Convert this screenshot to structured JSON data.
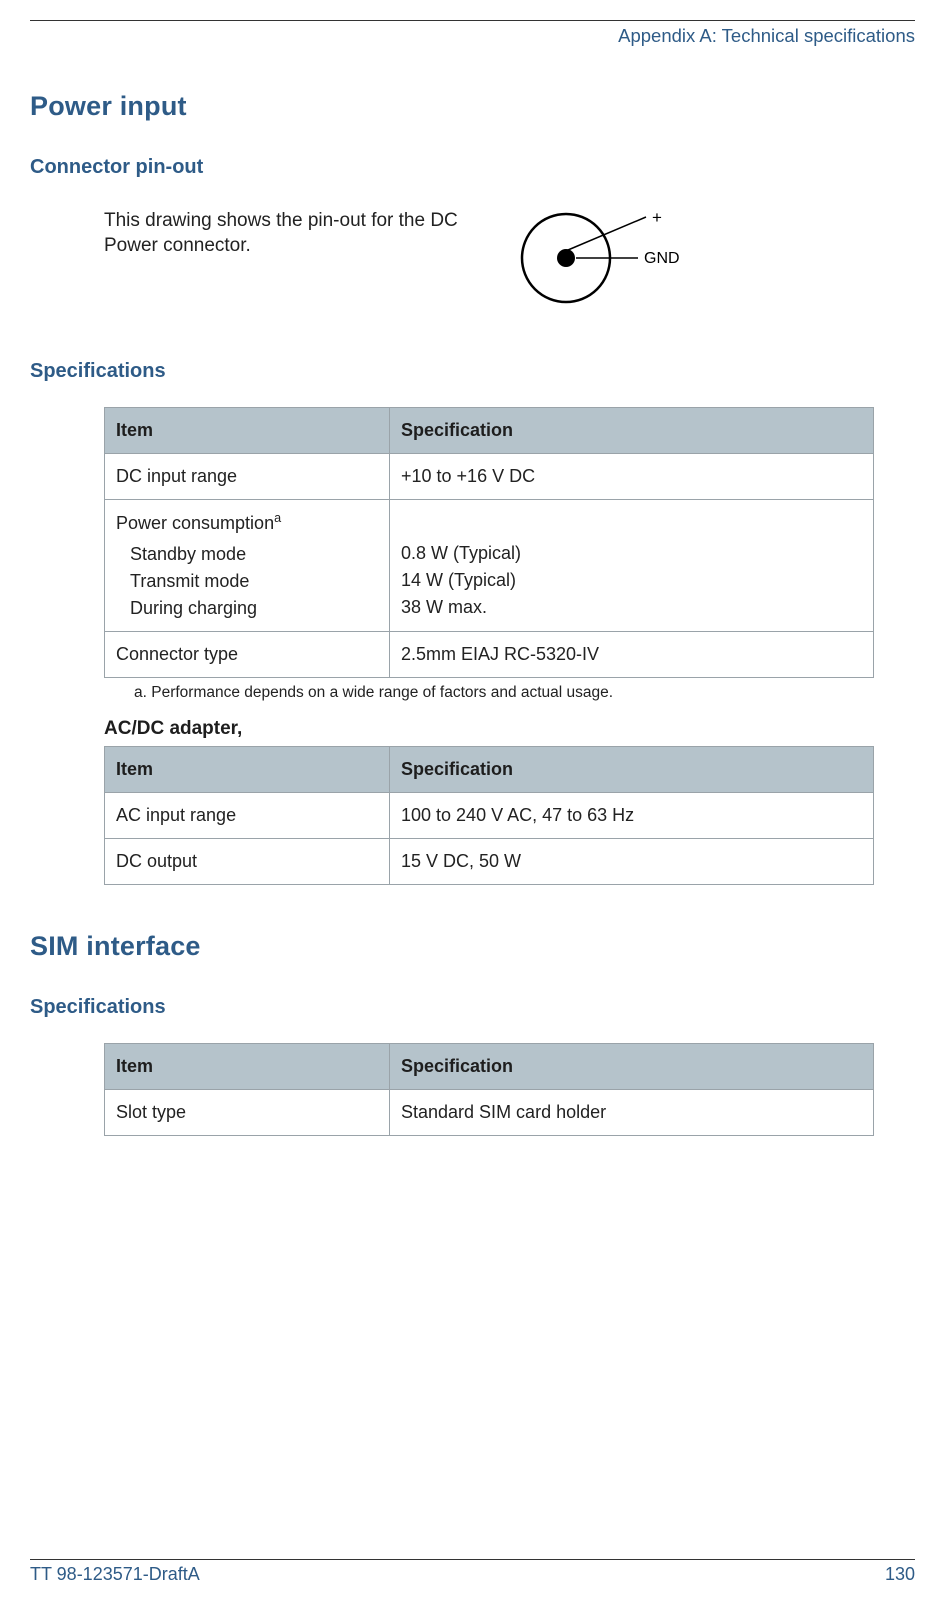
{
  "header": {
    "breadcrumb": "Appendix A: Technical specifications"
  },
  "sections": {
    "power_input": {
      "title": "Power input",
      "pinout": {
        "heading": "Connector pin-out",
        "text": "This drawing shows the pin-out for the DC Power connector.",
        "label_plus": "+",
        "label_gnd": "GND"
      },
      "specs": {
        "heading": "Specifications",
        "columns": {
          "item": "Item",
          "spec": "Specification"
        },
        "rows": {
          "dc_range": {
            "item": "DC input range",
            "spec": "+10 to +16 V DC"
          },
          "power_consumption": {
            "item_label": "Power consumption",
            "sup": "a",
            "standby_item": "Standby mode",
            "standby_spec": "0.8 W (Typical)",
            "transmit_item": "Transmit mode",
            "transmit_spec": "14 W (Typical)",
            "charging_item": "During charging",
            "charging_spec": "38 W max."
          },
          "connector": {
            "item": "Connector type",
            "spec": "2.5mm EIAJ RC-5320-IV"
          }
        },
        "footnote": "a.  Performance depends on a wide range of factors and actual usage."
      },
      "adapter": {
        "heading": "AC/DC adapter,",
        "columns": {
          "item": "Item",
          "spec": "Specification"
        },
        "rows": {
          "ac_range": {
            "item": "AC input range",
            "spec": "100 to 240 V AC, 47 to 63 Hz"
          },
          "dc_out": {
            "item": "DC output",
            "spec": "15 V DC, 50 W"
          }
        }
      }
    },
    "sim": {
      "title": "SIM interface",
      "specs": {
        "heading": "Specifications",
        "columns": {
          "item": "Item",
          "spec": "Specification"
        },
        "rows": {
          "slot": {
            "item": "Slot type",
            "spec": "Standard SIM card holder"
          }
        }
      }
    }
  },
  "footer": {
    "doc_id": "TT 98-123571-DraftA",
    "page": "130"
  }
}
